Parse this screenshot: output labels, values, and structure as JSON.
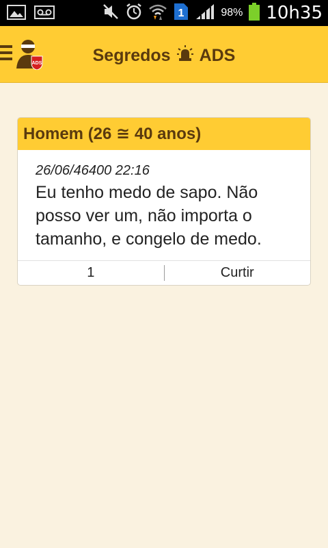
{
  "status_bar": {
    "battery_percent": "98%",
    "time": "10h35",
    "sim_slot": "1"
  },
  "appbar": {
    "title_left": "Segredos",
    "title_right": "ADS",
    "logo_badge": "ADS"
  },
  "post": {
    "header": "Homem (26 ≅ 40 anos)",
    "date": "26/06/46400 22:16",
    "text": "Eu tenho medo de sapo. Não posso ver um, não importa o tamanho, e congelo de medo.",
    "like_count": "1",
    "like_label": "Curtir"
  },
  "colors": {
    "accent": "#ffcc33",
    "text_brown": "#5a3a0e",
    "background": "#faf2e0"
  }
}
